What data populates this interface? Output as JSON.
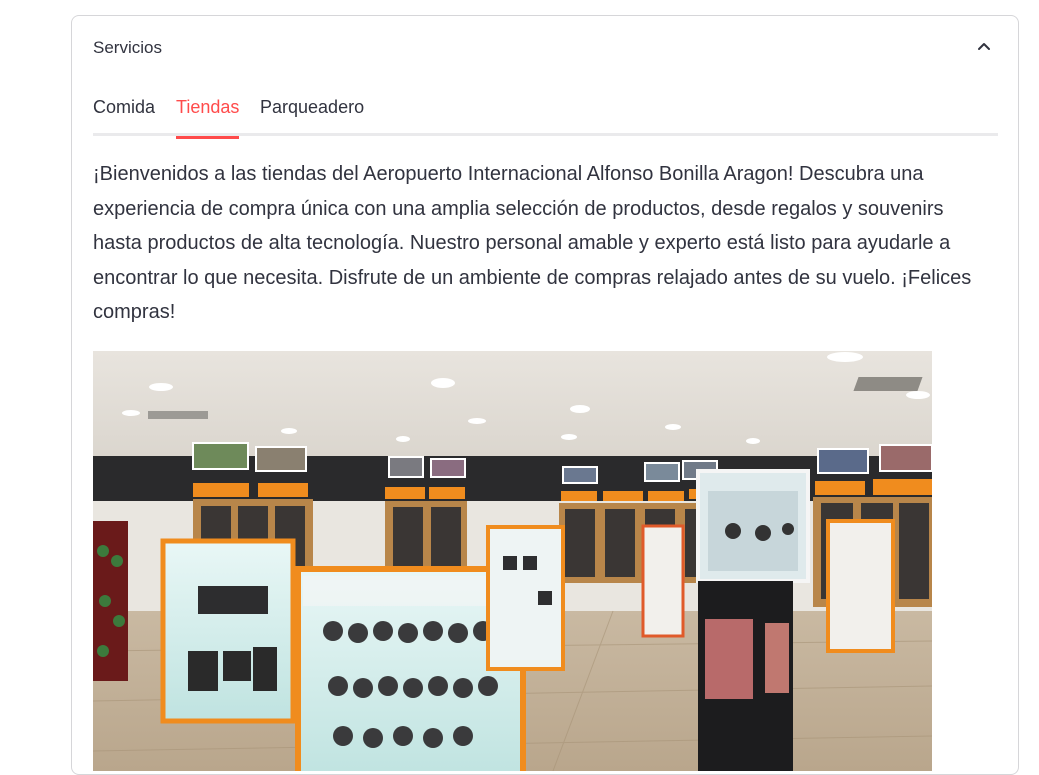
{
  "expander": {
    "title": "Servicios",
    "toggle_icon": "chevron-up-icon"
  },
  "tabs": [
    {
      "label": "Comida",
      "active": false
    },
    {
      "label": "Tiendas",
      "active": true
    },
    {
      "label": "Parqueadero",
      "active": false
    }
  ],
  "content": {
    "description": "¡Bienvenidos a las tiendas del Aeropuerto Internacional Alfonso Bonilla Aragon! Descubra una experiencia de compra única con una amplia selección de productos, desde regalos y souvenirs hasta productos de alta tecnología. Nuestro personal amable y experto está listo para ayudarle a encontrar lo que necesita. Disfrute de un ambiente de compras relajado antes de su vuelo. ¡Felices compras!",
    "image_subject": "airport-duty-free-store-photo"
  },
  "colors": {
    "accent": "#ff4b4b",
    "text": "#31333f",
    "border": "#d6d6d9",
    "tab_track": "#eaeaec"
  }
}
